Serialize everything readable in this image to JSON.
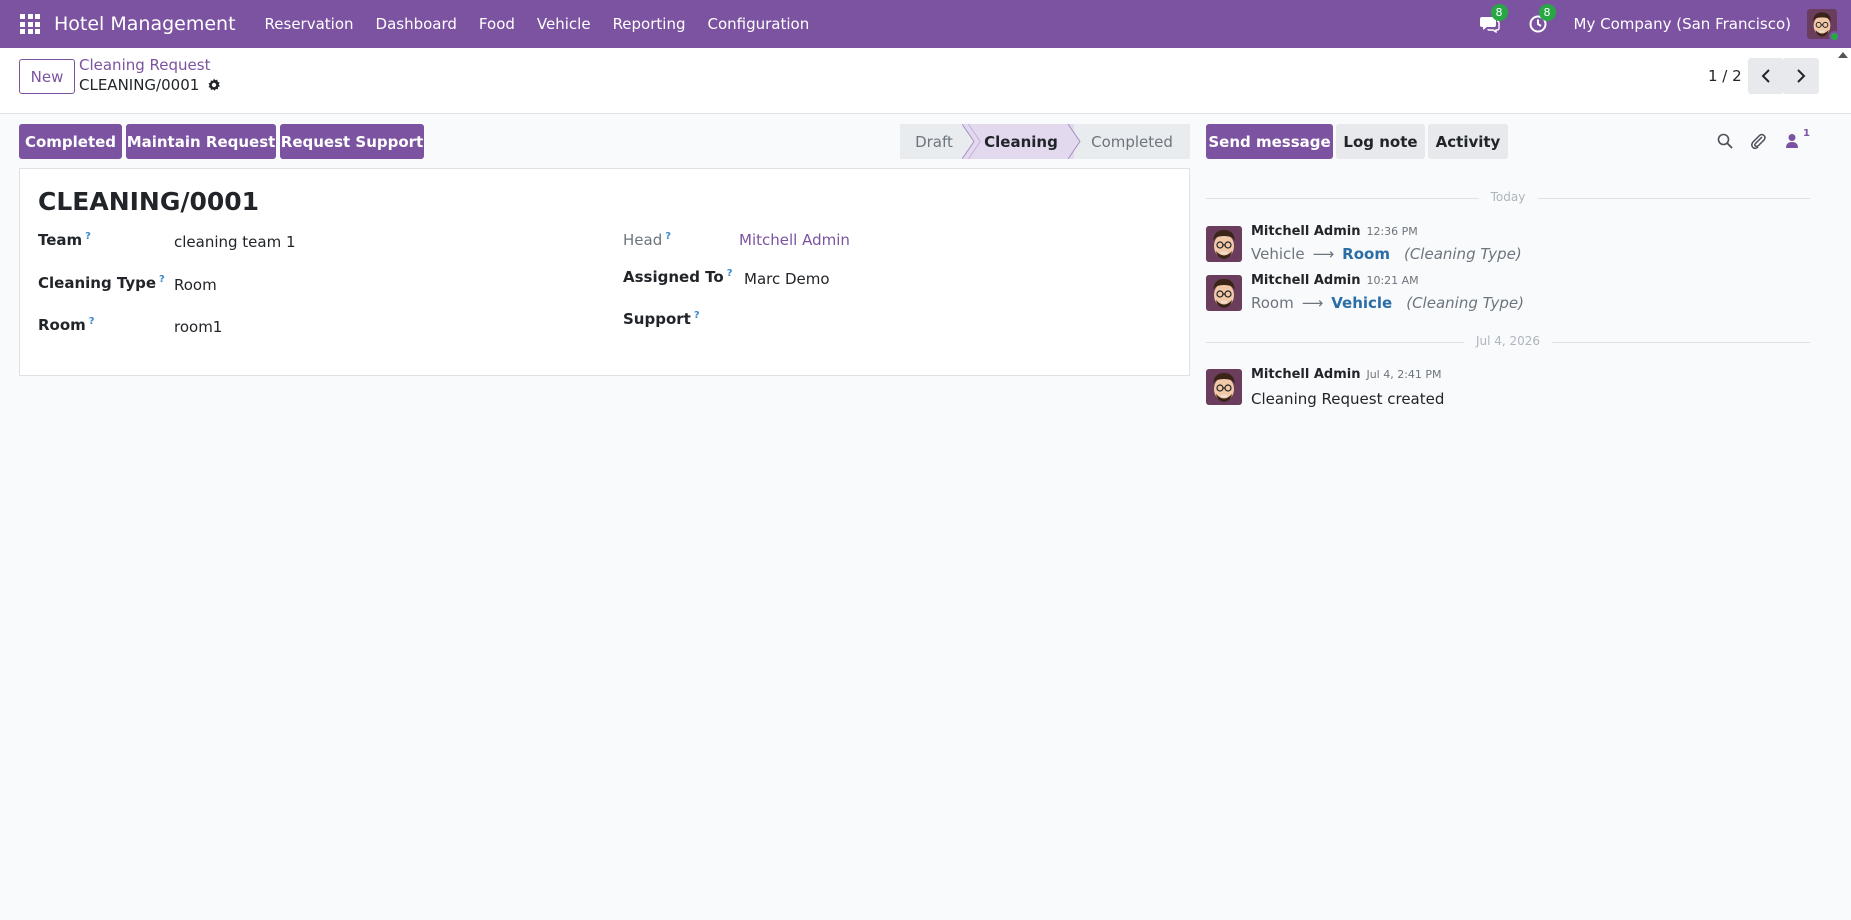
{
  "navbar": {
    "app_title": "Hotel Management",
    "menu": [
      "Reservation",
      "Dashboard",
      "Food",
      "Vehicle",
      "Reporting",
      "Configuration"
    ],
    "messages_badge": "8",
    "activities_badge": "8",
    "company": "My Company (San Francisco)",
    "color": "#7c53a0"
  },
  "control_panel": {
    "new_label": "New",
    "breadcrumb_parent": "Cleaning Request",
    "breadcrumb_current": "CLEANING/0001",
    "pager": "1 / 2"
  },
  "actions": {
    "completed": "Completed",
    "maintain": "Maintain Request",
    "support": "Request Support"
  },
  "status": {
    "stages": [
      "Draft",
      "Cleaning",
      "Completed"
    ],
    "current": "Cleaning"
  },
  "form": {
    "title": "CLEANING/0001",
    "help_mark": "?",
    "fields": {
      "team": {
        "label": "Team",
        "value": "cleaning team 1"
      },
      "cleaning_type": {
        "label": "Cleaning Type",
        "value": "Room"
      },
      "room": {
        "label": "Room",
        "value": "room1"
      },
      "head": {
        "label": "Head",
        "value": "Mitchell Admin"
      },
      "assigned_to": {
        "label": "Assigned To",
        "value": "Marc Demo"
      },
      "support": {
        "label": "Support",
        "value": ""
      }
    }
  },
  "chatter": {
    "send_message": "Send message",
    "log_note": "Log note",
    "activity": "Activity",
    "followers_count": "1",
    "date_today": "Today",
    "date_older": "Jul 4, 2026",
    "messages": [
      {
        "author": "Mitchell Admin",
        "time": "12:36 PM",
        "old": "Vehicle",
        "new": "Room",
        "field": "(Cleaning Type)"
      },
      {
        "author": "Mitchell Admin",
        "time": "10:21 AM",
        "old": "Room",
        "new": "Vehicle",
        "field": "(Cleaning Type)"
      },
      {
        "author": "Mitchell Admin",
        "time": "Jul 4, 2:41 PM",
        "body": "Cleaning Request created"
      }
    ]
  }
}
